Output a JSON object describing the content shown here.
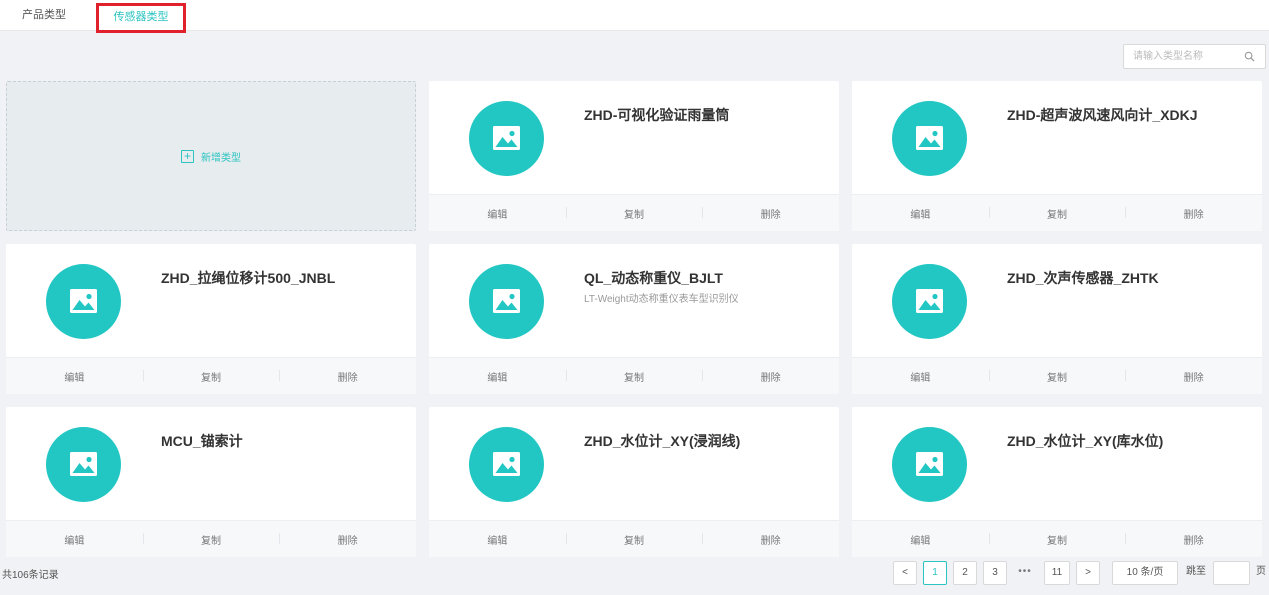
{
  "tabs": [
    {
      "label": "产品类型"
    },
    {
      "label": "传感器类型"
    }
  ],
  "search": {
    "placeholder": "请输入类型名称"
  },
  "add_card": {
    "label": "新增类型"
  },
  "actions": {
    "edit": "编辑",
    "copy": "复制",
    "delete": "删除"
  },
  "cards": [
    {
      "title": "ZHD-可视化验证雨量筒",
      "subtitle": ""
    },
    {
      "title": "ZHD-超声波风速风向计_XDKJ",
      "subtitle": ""
    },
    {
      "title": "ZHD_拉绳位移计500_JNBL",
      "subtitle": ""
    },
    {
      "title": "QL_动态称重仪_BJLT",
      "subtitle": "LT-Weight动态称重仪表车型识别仪"
    },
    {
      "title": "ZHD_次声传感器_ZHTK",
      "subtitle": ""
    },
    {
      "title": "MCU_锚索计",
      "subtitle": ""
    },
    {
      "title": "ZHD_水位计_XY(浸润线)",
      "subtitle": ""
    },
    {
      "title": "ZHD_水位计_XY(库水位)",
      "subtitle": ""
    }
  ],
  "footer": {
    "total": "共106条记录",
    "prev": "<",
    "pages": [
      "1",
      "2",
      "3"
    ],
    "ellipsis": "•••",
    "last_page": "11",
    "next": ">",
    "page_size": "10 条/页",
    "jump_label": "跳至",
    "page_suffix": "页"
  },
  "colors": {
    "accent": "#2bc4c1",
    "highlight_border": "#e0202a",
    "avatar": "#22c7c4"
  }
}
